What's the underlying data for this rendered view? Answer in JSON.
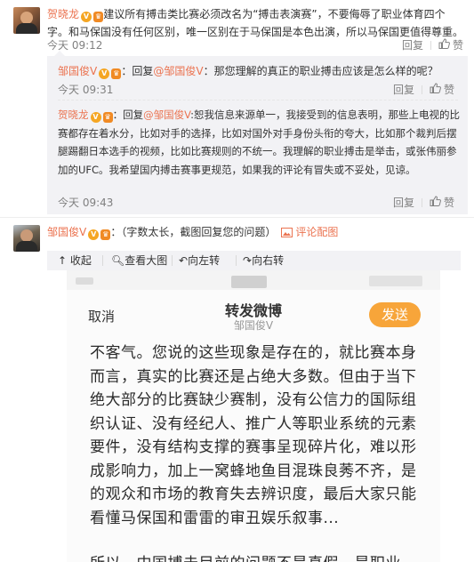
{
  "comment1": {
    "author": "贺晓龙",
    "text": "建议所有搏击类比赛必须改名为“搏击表演赛”，不要侮辱了职业体育四个字。和马保国没有任何区别，唯一区别在于马保国是本色出演，所以马保国更值得尊重。",
    "time": "今天 09:12",
    "action_reply": "回复",
    "action_like": "赞"
  },
  "reply1": {
    "author": "邹国俊V",
    "prefix": "：回复",
    "mention": "@邹国俊V",
    "text": "：那您理解的真正的职业搏击应该是怎么样的呢？",
    "time": "今天 09:31",
    "action_reply": "回复",
    "action_like": "赞"
  },
  "reply2": {
    "author": "贺晓龙",
    "prefix": "：回复",
    "mention": "@邹国俊V",
    "text": ":恕我信息来源单一，我接受到的信息表明，那些上电视的比赛都存在着水分，比如对手的选择，比如对国外对手身份头衔的夸大，比如那个裁判后摆腿踢翻日本选手的视频，比如比赛规则的不统一。我理解的职业搏击是举击，或张伟丽参加的UFC。我希望国内搏击赛事更规范，如果我的评论有冒失或不妥处，见谅。",
    "time": "今天 09:43",
    "action_reply": "回复",
    "action_like": "赞"
  },
  "comment2": {
    "author": "邹国俊V",
    "text": "：（字数太长，截图回复您的问题）",
    "image_link": "评论配图"
  },
  "image_toolbar": {
    "collapse": "收起",
    "view_large": "查看大图",
    "rotate_left": "向左转",
    "rotate_right": "向右转"
  },
  "screenshot": {
    "cancel": "取消",
    "title": "转发微博",
    "subtitle": "邹国俊V",
    "send": "发送",
    "body": "不客气。您说的这些现象是存在的，就比赛本身而言，真实的比赛还是占绝大多数。但由于当下绝大部分的比赛缺少赛制，没有公信力的国际组织认证、没有经纪人、推广人等职业系统的元素要件，没有结构支撑的赛事呈现碎片化，难以形成影响力，加上一窝蜂地鱼目混珠良莠不齐，是的观众和市场的教育失去辨识度，最后大家只能看懂马保国和雷雷的审丑娱乐叙事...",
    "body_last": "所以，中国搏击目前的问题不是真假，是职业"
  },
  "colors": {
    "link": "#eb7350",
    "muted": "#808080",
    "reply_bg": "#f2f2f5",
    "send_button": "#f7a53a"
  }
}
